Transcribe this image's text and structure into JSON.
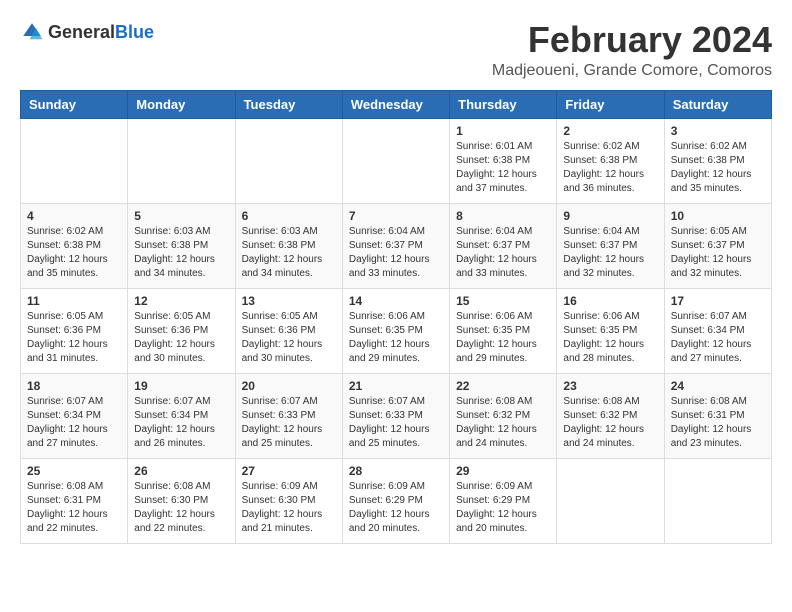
{
  "header": {
    "logo_general": "General",
    "logo_blue": "Blue",
    "title": "February 2024",
    "subtitle": "Madjeoueni, Grande Comore, Comoros"
  },
  "calendar": {
    "days_of_week": [
      "Sunday",
      "Monday",
      "Tuesday",
      "Wednesday",
      "Thursday",
      "Friday",
      "Saturday"
    ],
    "weeks": [
      [
        {
          "day": "",
          "info": ""
        },
        {
          "day": "",
          "info": ""
        },
        {
          "day": "",
          "info": ""
        },
        {
          "day": "",
          "info": ""
        },
        {
          "day": "1",
          "info": "Sunrise: 6:01 AM\nSunset: 6:38 PM\nDaylight: 12 hours and 37 minutes."
        },
        {
          "day": "2",
          "info": "Sunrise: 6:02 AM\nSunset: 6:38 PM\nDaylight: 12 hours and 36 minutes."
        },
        {
          "day": "3",
          "info": "Sunrise: 6:02 AM\nSunset: 6:38 PM\nDaylight: 12 hours and 35 minutes."
        }
      ],
      [
        {
          "day": "4",
          "info": "Sunrise: 6:02 AM\nSunset: 6:38 PM\nDaylight: 12 hours and 35 minutes."
        },
        {
          "day": "5",
          "info": "Sunrise: 6:03 AM\nSunset: 6:38 PM\nDaylight: 12 hours and 34 minutes."
        },
        {
          "day": "6",
          "info": "Sunrise: 6:03 AM\nSunset: 6:38 PM\nDaylight: 12 hours and 34 minutes."
        },
        {
          "day": "7",
          "info": "Sunrise: 6:04 AM\nSunset: 6:37 PM\nDaylight: 12 hours and 33 minutes."
        },
        {
          "day": "8",
          "info": "Sunrise: 6:04 AM\nSunset: 6:37 PM\nDaylight: 12 hours and 33 minutes."
        },
        {
          "day": "9",
          "info": "Sunrise: 6:04 AM\nSunset: 6:37 PM\nDaylight: 12 hours and 32 minutes."
        },
        {
          "day": "10",
          "info": "Sunrise: 6:05 AM\nSunset: 6:37 PM\nDaylight: 12 hours and 32 minutes."
        }
      ],
      [
        {
          "day": "11",
          "info": "Sunrise: 6:05 AM\nSunset: 6:36 PM\nDaylight: 12 hours and 31 minutes."
        },
        {
          "day": "12",
          "info": "Sunrise: 6:05 AM\nSunset: 6:36 PM\nDaylight: 12 hours and 30 minutes."
        },
        {
          "day": "13",
          "info": "Sunrise: 6:05 AM\nSunset: 6:36 PM\nDaylight: 12 hours and 30 minutes."
        },
        {
          "day": "14",
          "info": "Sunrise: 6:06 AM\nSunset: 6:35 PM\nDaylight: 12 hours and 29 minutes."
        },
        {
          "day": "15",
          "info": "Sunrise: 6:06 AM\nSunset: 6:35 PM\nDaylight: 12 hours and 29 minutes."
        },
        {
          "day": "16",
          "info": "Sunrise: 6:06 AM\nSunset: 6:35 PM\nDaylight: 12 hours and 28 minutes."
        },
        {
          "day": "17",
          "info": "Sunrise: 6:07 AM\nSunset: 6:34 PM\nDaylight: 12 hours and 27 minutes."
        }
      ],
      [
        {
          "day": "18",
          "info": "Sunrise: 6:07 AM\nSunset: 6:34 PM\nDaylight: 12 hours and 27 minutes."
        },
        {
          "day": "19",
          "info": "Sunrise: 6:07 AM\nSunset: 6:34 PM\nDaylight: 12 hours and 26 minutes."
        },
        {
          "day": "20",
          "info": "Sunrise: 6:07 AM\nSunset: 6:33 PM\nDaylight: 12 hours and 25 minutes."
        },
        {
          "day": "21",
          "info": "Sunrise: 6:07 AM\nSunset: 6:33 PM\nDaylight: 12 hours and 25 minutes."
        },
        {
          "day": "22",
          "info": "Sunrise: 6:08 AM\nSunset: 6:32 PM\nDaylight: 12 hours and 24 minutes."
        },
        {
          "day": "23",
          "info": "Sunrise: 6:08 AM\nSunset: 6:32 PM\nDaylight: 12 hours and 24 minutes."
        },
        {
          "day": "24",
          "info": "Sunrise: 6:08 AM\nSunset: 6:31 PM\nDaylight: 12 hours and 23 minutes."
        }
      ],
      [
        {
          "day": "25",
          "info": "Sunrise: 6:08 AM\nSunset: 6:31 PM\nDaylight: 12 hours and 22 minutes."
        },
        {
          "day": "26",
          "info": "Sunrise: 6:08 AM\nSunset: 6:30 PM\nDaylight: 12 hours and 22 minutes."
        },
        {
          "day": "27",
          "info": "Sunrise: 6:09 AM\nSunset: 6:30 PM\nDaylight: 12 hours and 21 minutes."
        },
        {
          "day": "28",
          "info": "Sunrise: 6:09 AM\nSunset: 6:29 PM\nDaylight: 12 hours and 20 minutes."
        },
        {
          "day": "29",
          "info": "Sunrise: 6:09 AM\nSunset: 6:29 PM\nDaylight: 12 hours and 20 minutes."
        },
        {
          "day": "",
          "info": ""
        },
        {
          "day": "",
          "info": ""
        }
      ]
    ]
  }
}
